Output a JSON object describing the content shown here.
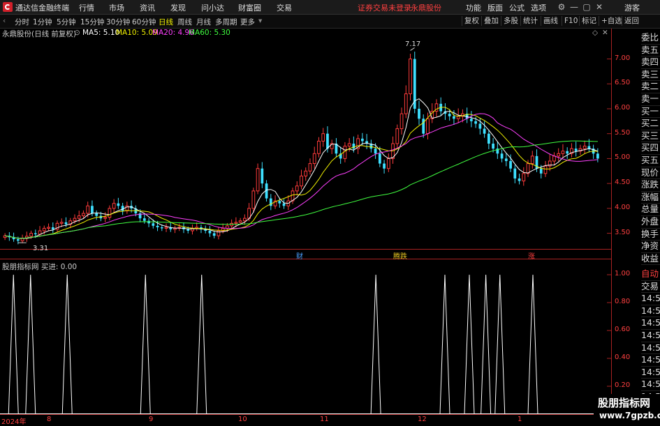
{
  "app": {
    "title": "通达信金融终端",
    "menu": [
      "行情",
      "市场",
      "资讯",
      "发现",
      "问小达",
      "财富圈",
      "交易"
    ],
    "notice": "证券交易未登录",
    "stock_name_top": "永鼎股份",
    "right_menu": [
      "功能",
      "版面",
      "公式",
      "选项"
    ],
    "guest": "游客",
    "win_buttons": [
      "⚙",
      "—",
      "▢",
      "✕"
    ]
  },
  "toolbar": {
    "periods": [
      "分时",
      "1分钟",
      "5分钟",
      "15分钟",
      "30分钟",
      "60分钟",
      "日线",
      "周线",
      "月线",
      "多周期",
      "更多"
    ],
    "active_period": "日线",
    "right_tools": [
      "复权",
      "叠加",
      "多股",
      "统计",
      "画线",
      "F10",
      "标记",
      "+自选",
      "返回"
    ]
  },
  "main_header": {
    "name": "永鼎股份(日线 前复权)",
    "ma": [
      {
        "label": "MA5: 5.10",
        "color": "#ffffff"
      },
      {
        "label": "MA10: 5.09",
        "color": "#f0f000"
      },
      {
        "label": "MA20: 4.96",
        "color": "#ff40ff"
      },
      {
        "label": "MA60: 5.30",
        "color": "#40ff40"
      }
    ]
  },
  "annotations": {
    "high": "7.17",
    "low": "3.31"
  },
  "events": [
    {
      "label": "财",
      "color": "#4aa0ff"
    },
    {
      "label": "腾跌",
      "color": "#e0c020"
    },
    {
      "label": "涨",
      "color": "#ff4040"
    }
  ],
  "indicator_header": "股朋指标网 买进: 0.00",
  "right_panel": {
    "quote_rows": [
      "委比",
      "卖五",
      "卖四",
      "卖三",
      "卖二",
      "卖一",
      "买一",
      "买二",
      "买三",
      "买四",
      "买五",
      "现价",
      "涨跌",
      "涨幅",
      "总量",
      "外盘",
      "换手",
      "净资",
      "收益"
    ],
    "trade_rows": [
      "自动",
      "交易",
      "14:56",
      "14:56",
      "14:56",
      "14:56",
      "14:56",
      "14:56",
      "14:56",
      "14:56",
      "14:56",
      "14:56"
    ]
  },
  "x_labels": [
    "2024年",
    "8",
    "9",
    "10",
    "11",
    "12",
    "1"
  ],
  "watermark": {
    "line1": "股朋指标网",
    "line2": "www.7gpzb.com"
  },
  "chart_data": [
    {
      "type": "candlestick",
      "title": "永鼎股份(日线 前复权)",
      "ylim": [
        3.2,
        7.4
      ],
      "yticks": [
        3.5,
        4.0,
        4.5,
        5.0,
        5.5,
        6.0,
        6.5,
        7.0
      ],
      "ytick_labels": [
        "3.50",
        "4.00",
        "4.50",
        "5.00",
        "5.50",
        "6.00",
        "6.50",
        "7.00"
      ],
      "high_label": 7.17,
      "low_label": 3.31,
      "closes": [
        3.45,
        3.42,
        3.38,
        3.35,
        3.4,
        3.44,
        3.5,
        3.48,
        3.55,
        3.6,
        3.62,
        3.58,
        3.7,
        3.72,
        3.68,
        3.75,
        3.8,
        3.85,
        3.9,
        4.05,
        3.9,
        3.85,
        3.8,
        3.82,
        4.0,
        4.1,
        4.05,
        3.95,
        4.05,
        4.0,
        3.9,
        3.8,
        3.75,
        3.7,
        3.65,
        3.62,
        3.6,
        3.62,
        3.58,
        3.6,
        3.62,
        3.58,
        3.55,
        3.6,
        3.62,
        3.58,
        3.55,
        3.5,
        3.45,
        3.55,
        3.6,
        3.65,
        3.7,
        3.72,
        3.75,
        3.8,
        4.0,
        4.35,
        4.8,
        4.5,
        4.2,
        4.05,
        4.15,
        4.1,
        4.05,
        4.15,
        4.35,
        4.45,
        4.65,
        4.75,
        4.9,
        5.1,
        5.35,
        5.5,
        5.2,
        5.3,
        5.1,
        5.0,
        5.25,
        5.3,
        5.2,
        5.4,
        5.35,
        5.3,
        5.2,
        5.1,
        4.9,
        4.8,
        5.0,
        5.3,
        5.6,
        5.9,
        6.3,
        7.0,
        6.0,
        5.8,
        5.5,
        5.8,
        5.95,
        6.1,
        5.95,
        5.9,
        5.85,
        5.8,
        5.85,
        5.9,
        5.8,
        5.75,
        5.7,
        5.6,
        5.5,
        5.3,
        5.2,
        5.1,
        5.0,
        4.95,
        4.8,
        4.6,
        4.55,
        4.7,
        4.9,
        5.05,
        4.8,
        4.7,
        4.85,
        4.95,
        5.05,
        5.1,
        5.15,
        5.1,
        5.2,
        5.15,
        5.2,
        5.25,
        5.2,
        5.1,
        5.0
      ]
    },
    {
      "type": "line",
      "title": "股朋指标网 买进: 0.00",
      "ylim": [
        0,
        1.1
      ],
      "yticks": [
        0.2,
        0.4,
        0.6,
        0.8,
        1.0
      ],
      "ytick_labels": [
        "0.20",
        "0.40",
        "0.60",
        "0.80",
        "1.00"
      ],
      "spike_x_fraction": [
        0.022,
        0.05,
        0.11,
        0.238,
        0.33,
        0.615,
        0.728,
        0.768,
        0.795,
        0.818,
        0.872
      ],
      "spike_value": 1.0
    }
  ]
}
